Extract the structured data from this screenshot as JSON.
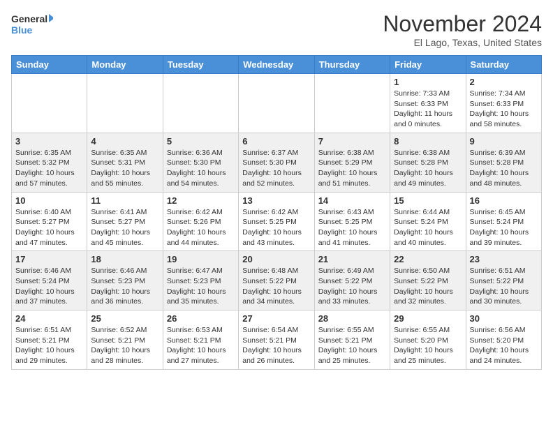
{
  "logo": {
    "line1": "General",
    "line2": "Blue"
  },
  "title": "November 2024",
  "location": "El Lago, Texas, United States",
  "weekdays": [
    "Sunday",
    "Monday",
    "Tuesday",
    "Wednesday",
    "Thursday",
    "Friday",
    "Saturday"
  ],
  "weeks": [
    [
      {
        "day": "",
        "info": ""
      },
      {
        "day": "",
        "info": ""
      },
      {
        "day": "",
        "info": ""
      },
      {
        "day": "",
        "info": ""
      },
      {
        "day": "",
        "info": ""
      },
      {
        "day": "1",
        "info": "Sunrise: 7:33 AM\nSunset: 6:33 PM\nDaylight: 11 hours\nand 0 minutes."
      },
      {
        "day": "2",
        "info": "Sunrise: 7:34 AM\nSunset: 6:33 PM\nDaylight: 10 hours\nand 58 minutes."
      }
    ],
    [
      {
        "day": "3",
        "info": "Sunrise: 6:35 AM\nSunset: 5:32 PM\nDaylight: 10 hours\nand 57 minutes."
      },
      {
        "day": "4",
        "info": "Sunrise: 6:35 AM\nSunset: 5:31 PM\nDaylight: 10 hours\nand 55 minutes."
      },
      {
        "day": "5",
        "info": "Sunrise: 6:36 AM\nSunset: 5:30 PM\nDaylight: 10 hours\nand 54 minutes."
      },
      {
        "day": "6",
        "info": "Sunrise: 6:37 AM\nSunset: 5:30 PM\nDaylight: 10 hours\nand 52 minutes."
      },
      {
        "day": "7",
        "info": "Sunrise: 6:38 AM\nSunset: 5:29 PM\nDaylight: 10 hours\nand 51 minutes."
      },
      {
        "day": "8",
        "info": "Sunrise: 6:38 AM\nSunset: 5:28 PM\nDaylight: 10 hours\nand 49 minutes."
      },
      {
        "day": "9",
        "info": "Sunrise: 6:39 AM\nSunset: 5:28 PM\nDaylight: 10 hours\nand 48 minutes."
      }
    ],
    [
      {
        "day": "10",
        "info": "Sunrise: 6:40 AM\nSunset: 5:27 PM\nDaylight: 10 hours\nand 47 minutes."
      },
      {
        "day": "11",
        "info": "Sunrise: 6:41 AM\nSunset: 5:27 PM\nDaylight: 10 hours\nand 45 minutes."
      },
      {
        "day": "12",
        "info": "Sunrise: 6:42 AM\nSunset: 5:26 PM\nDaylight: 10 hours\nand 44 minutes."
      },
      {
        "day": "13",
        "info": "Sunrise: 6:42 AM\nSunset: 5:25 PM\nDaylight: 10 hours\nand 43 minutes."
      },
      {
        "day": "14",
        "info": "Sunrise: 6:43 AM\nSunset: 5:25 PM\nDaylight: 10 hours\nand 41 minutes."
      },
      {
        "day": "15",
        "info": "Sunrise: 6:44 AM\nSunset: 5:24 PM\nDaylight: 10 hours\nand 40 minutes."
      },
      {
        "day": "16",
        "info": "Sunrise: 6:45 AM\nSunset: 5:24 PM\nDaylight: 10 hours\nand 39 minutes."
      }
    ],
    [
      {
        "day": "17",
        "info": "Sunrise: 6:46 AM\nSunset: 5:24 PM\nDaylight: 10 hours\nand 37 minutes."
      },
      {
        "day": "18",
        "info": "Sunrise: 6:46 AM\nSunset: 5:23 PM\nDaylight: 10 hours\nand 36 minutes."
      },
      {
        "day": "19",
        "info": "Sunrise: 6:47 AM\nSunset: 5:23 PM\nDaylight: 10 hours\nand 35 minutes."
      },
      {
        "day": "20",
        "info": "Sunrise: 6:48 AM\nSunset: 5:22 PM\nDaylight: 10 hours\nand 34 minutes."
      },
      {
        "day": "21",
        "info": "Sunrise: 6:49 AM\nSunset: 5:22 PM\nDaylight: 10 hours\nand 33 minutes."
      },
      {
        "day": "22",
        "info": "Sunrise: 6:50 AM\nSunset: 5:22 PM\nDaylight: 10 hours\nand 32 minutes."
      },
      {
        "day": "23",
        "info": "Sunrise: 6:51 AM\nSunset: 5:22 PM\nDaylight: 10 hours\nand 30 minutes."
      }
    ],
    [
      {
        "day": "24",
        "info": "Sunrise: 6:51 AM\nSunset: 5:21 PM\nDaylight: 10 hours\nand 29 minutes."
      },
      {
        "day": "25",
        "info": "Sunrise: 6:52 AM\nSunset: 5:21 PM\nDaylight: 10 hours\nand 28 minutes."
      },
      {
        "day": "26",
        "info": "Sunrise: 6:53 AM\nSunset: 5:21 PM\nDaylight: 10 hours\nand 27 minutes."
      },
      {
        "day": "27",
        "info": "Sunrise: 6:54 AM\nSunset: 5:21 PM\nDaylight: 10 hours\nand 26 minutes."
      },
      {
        "day": "28",
        "info": "Sunrise: 6:55 AM\nSunset: 5:21 PM\nDaylight: 10 hours\nand 25 minutes."
      },
      {
        "day": "29",
        "info": "Sunrise: 6:55 AM\nSunset: 5:20 PM\nDaylight: 10 hours\nand 25 minutes."
      },
      {
        "day": "30",
        "info": "Sunrise: 6:56 AM\nSunset: 5:20 PM\nDaylight: 10 hours\nand 24 minutes."
      }
    ]
  ]
}
